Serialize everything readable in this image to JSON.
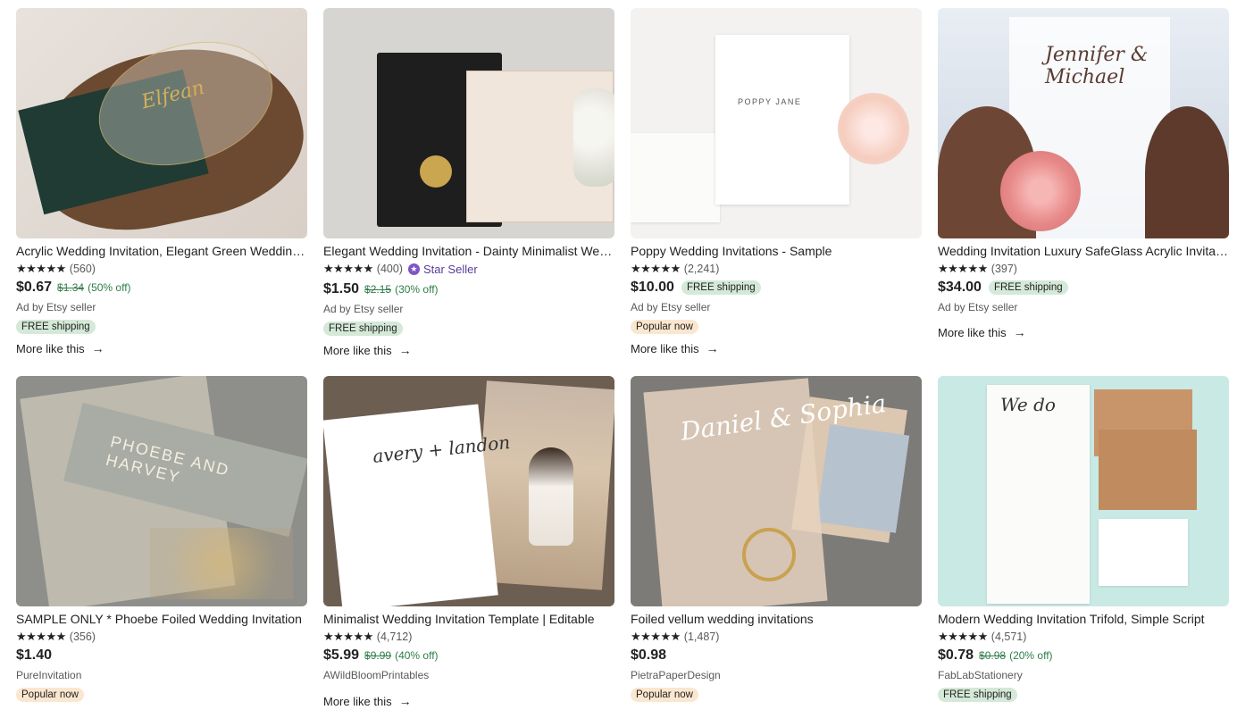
{
  "listings": [
    {
      "title": "Acrylic Wedding Invitation, Elegant Green Wedding Invitation",
      "stars": "★★★★★",
      "reviews": "(560)",
      "price": "$0.67",
      "original_price": "$1.34",
      "discount": "(50% off)",
      "seller": "Ad by Etsy seller",
      "badge": "FREE shipping",
      "more": "More like this"
    },
    {
      "title": "Elegant Wedding Invitation - Dainty Minimalist Wedding Invitation",
      "stars": "★★★★★",
      "reviews": "(400)",
      "star_seller": "Star Seller",
      "price": "$1.50",
      "original_price": "$2.15",
      "discount": "(30% off)",
      "seller": "Ad by Etsy seller",
      "badge": "FREE shipping",
      "more": "More like this"
    },
    {
      "title": "Poppy Wedding Invitations - Sample",
      "stars": "★★★★★",
      "reviews": "(2,241)",
      "price": "$10.00",
      "inline_badge": "FREE shipping",
      "seller": "Ad by Etsy seller",
      "badge": "Popular now",
      "more": "More like this"
    },
    {
      "title": "Wedding Invitation Luxury SafeGlass Acrylic Invitation",
      "stars": "★★★★★",
      "reviews": "(397)",
      "price": "$34.00",
      "inline_badge": "FREE shipping",
      "seller": "Ad by Etsy seller",
      "more": "More like this"
    },
    {
      "title": "SAMPLE ONLY * Phoebe Foiled Wedding Invitation",
      "stars": "★★★★★",
      "reviews": "(356)",
      "price": "$1.40",
      "seller": "PureInvitation",
      "badge": "Popular now"
    },
    {
      "title": "Minimalist Wedding Invitation Template | Editable",
      "stars": "★★★★★",
      "reviews": "(4,712)",
      "price": "$5.99",
      "original_price": "$9.99",
      "discount": "(40% off)",
      "seller": "AWildBloomPrintables",
      "more": "More like this"
    },
    {
      "title": "Foiled vellum wedding invitations",
      "stars": "★★★★★",
      "reviews": "(1,487)",
      "price": "$0.98",
      "seller": "PietraPaperDesign",
      "badge": "Popular now"
    },
    {
      "title": "Modern Wedding Invitation Trifold, Simple Script",
      "stars": "★★★★★",
      "reviews": "(4,571)",
      "price": "$0.78",
      "original_price": "$0.98",
      "discount": "(20% off)",
      "seller": "FabLabStationery",
      "badge": "FREE shipping"
    }
  ],
  "image_text": {
    "t1": "Elfean",
    "t3": "POPPY JANE",
    "t4": "Jennifer & Michael",
    "t5": "PHOEBE AND HARVEY",
    "t6": "avery + landon",
    "t7": "Daniel & Sophia",
    "t8": "We do"
  },
  "colors": {
    "price_discount": "#2f7d4b",
    "free_shipping_bg": "#d4e9d7",
    "popular_bg": "#fbe6cf",
    "star_seller": "#7f54c6"
  }
}
